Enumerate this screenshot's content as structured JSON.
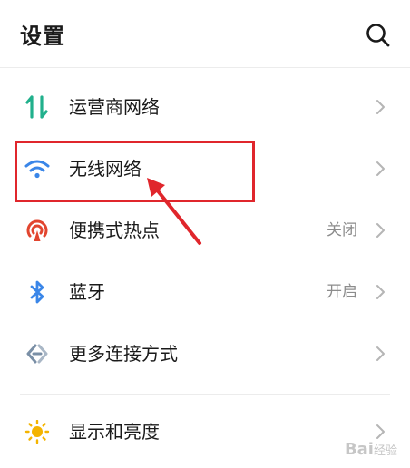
{
  "header": {
    "title": "设置",
    "search_icon": "search-icon"
  },
  "rows": [
    {
      "label": "运营商网络",
      "value": "",
      "icon": "mobile-data-icon",
      "color": "#21b08c"
    },
    {
      "label": "无线网络",
      "value": "",
      "icon": "wifi-icon",
      "color": "#3a86e8"
    },
    {
      "label": "便携式热点",
      "value": "关闭",
      "icon": "hotspot-icon",
      "color": "#e2452f"
    },
    {
      "label": "蓝牙",
      "value": "开启",
      "icon": "bluetooth-icon",
      "color": "#3a86e8"
    },
    {
      "label": "更多连接方式",
      "value": "",
      "icon": "more-connections-icon",
      "color": "#7a8fa6"
    },
    {
      "label": "显示和亮度",
      "value": "",
      "icon": "brightness-icon",
      "color": "#f4b400"
    }
  ],
  "annotation_color": "#e0262c",
  "watermark": {
    "text": "Bai",
    "sub": "经验"
  }
}
